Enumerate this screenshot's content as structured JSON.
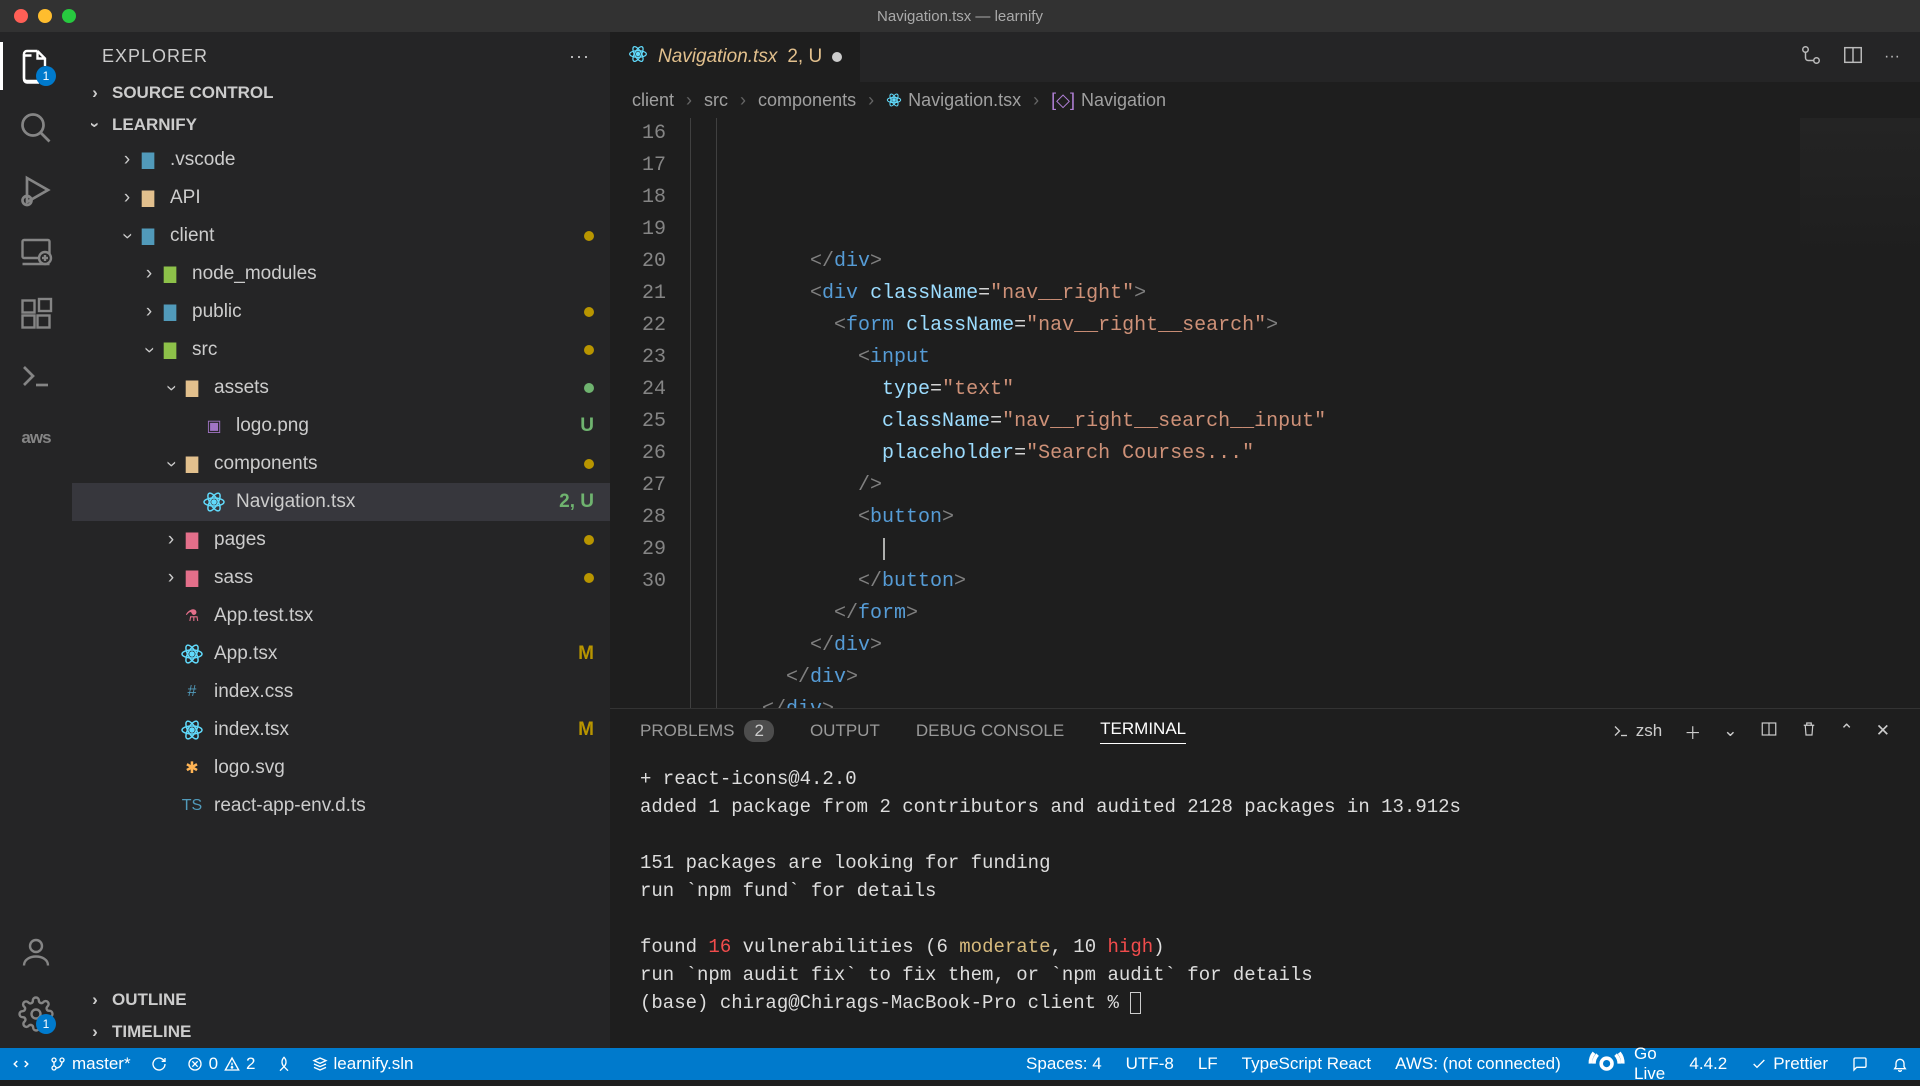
{
  "window": {
    "title": "Navigation.tsx — learnify"
  },
  "activity": {
    "explorer_badge": "1",
    "settings_badge": "1"
  },
  "explorer": {
    "title": "EXPLORER",
    "sections": {
      "source_control": "SOURCE CONTROL",
      "project": "LEARNIFY",
      "outline": "OUTLINE",
      "timeline": "TIMELINE"
    },
    "tree": [
      {
        "indent": 1,
        "chev": "right",
        "icon": "folder-blue",
        "label": ".vscode"
      },
      {
        "indent": 1,
        "chev": "right",
        "icon": "folder-yellow",
        "label": "API"
      },
      {
        "indent": 1,
        "chev": "down",
        "icon": "folder-blue",
        "label": "client",
        "dot": "yellow"
      },
      {
        "indent": 2,
        "chev": "right",
        "icon": "folder-green",
        "label": "node_modules"
      },
      {
        "indent": 2,
        "chev": "right",
        "icon": "folder-blue",
        "label": "public",
        "dot": "yellow"
      },
      {
        "indent": 2,
        "chev": "down",
        "icon": "folder-green",
        "label": "src",
        "dot": "yellow"
      },
      {
        "indent": 3,
        "chev": "down",
        "icon": "folder-yellow",
        "label": "assets",
        "dot": "green"
      },
      {
        "indent": 4,
        "icon": "image",
        "label": "logo.png",
        "status": "U",
        "statusClass": "u"
      },
      {
        "indent": 3,
        "chev": "down",
        "icon": "folder-yellow",
        "label": "components",
        "dot": "yellow"
      },
      {
        "indent": 4,
        "icon": "react",
        "label": "Navigation.tsx",
        "status": "2, U",
        "statusClass": "u",
        "selected": true
      },
      {
        "indent": 3,
        "chev": "right",
        "icon": "folder-pink",
        "label": "pages",
        "dot": "yellow"
      },
      {
        "indent": 3,
        "chev": "right",
        "icon": "folder-pink",
        "label": "sass",
        "dot": "yellow"
      },
      {
        "indent": 3,
        "icon": "test",
        "label": "App.test.tsx"
      },
      {
        "indent": 3,
        "icon": "react",
        "label": "App.tsx",
        "status": "M",
        "statusClass": "m"
      },
      {
        "indent": 3,
        "icon": "css",
        "label": "index.css"
      },
      {
        "indent": 3,
        "icon": "react",
        "label": "index.tsx",
        "status": "M",
        "statusClass": "m"
      },
      {
        "indent": 3,
        "icon": "svg",
        "label": "logo.svg"
      },
      {
        "indent": 3,
        "icon": "ts",
        "label": "react-app-env.d.ts"
      }
    ]
  },
  "tab": {
    "name": "Navigation.tsx",
    "badge": "2, U"
  },
  "breadcrumbs": [
    "client",
    "src",
    "components",
    "Navigation.tsx",
    "Navigation"
  ],
  "code": {
    "start": 16,
    "lines": [
      [
        [
          "brkt",
          "          </"
        ],
        [
          "tag",
          "div"
        ],
        [
          "brkt",
          ">"
        ]
      ],
      [
        [
          "brkt",
          "          <"
        ],
        [
          "tag",
          "div"
        ],
        [
          "eq",
          " "
        ],
        [
          "attr",
          "className"
        ],
        [
          "eq",
          "="
        ],
        [
          "str",
          "\"nav__right\""
        ],
        [
          "brkt",
          ">"
        ]
      ],
      [
        [
          "brkt",
          "            <"
        ],
        [
          "tag",
          "form"
        ],
        [
          "eq",
          " "
        ],
        [
          "attr",
          "className"
        ],
        [
          "eq",
          "="
        ],
        [
          "str",
          "\"nav__right__search\""
        ],
        [
          "brkt",
          ">"
        ]
      ],
      [
        [
          "brkt",
          "              <"
        ],
        [
          "tag",
          "input"
        ]
      ],
      [
        [
          "eq",
          "                "
        ],
        [
          "attr",
          "type"
        ],
        [
          "eq",
          "="
        ],
        [
          "str",
          "\"text\""
        ]
      ],
      [
        [
          "eq",
          "                "
        ],
        [
          "attr",
          "className"
        ],
        [
          "eq",
          "="
        ],
        [
          "str",
          "\"nav__right__search__input\""
        ]
      ],
      [
        [
          "eq",
          "                "
        ],
        [
          "attr",
          "placeholder"
        ],
        [
          "eq",
          "="
        ],
        [
          "str",
          "\"Search Courses...\""
        ]
      ],
      [
        [
          "brkt",
          "              />"
        ]
      ],
      [
        [
          "brkt",
          "              <"
        ],
        [
          "tag",
          "button"
        ],
        [
          "brkt",
          ">"
        ]
      ],
      [
        [
          "eq",
          "                "
        ]
      ],
      [
        [
          "brkt",
          "              </"
        ],
        [
          "tag",
          "button"
        ],
        [
          "brkt",
          ">"
        ]
      ],
      [
        [
          "brkt",
          "            </"
        ],
        [
          "tag",
          "form"
        ],
        [
          "brkt",
          ">"
        ]
      ],
      [
        [
          "brkt",
          "          </"
        ],
        [
          "tag",
          "div"
        ],
        [
          "brkt",
          ">"
        ]
      ],
      [
        [
          "brkt",
          "        </"
        ],
        [
          "tag",
          "div"
        ],
        [
          "brkt",
          ">"
        ]
      ],
      [
        [
          "brkt",
          "      </"
        ],
        [
          "tag",
          "div"
        ],
        [
          "brkt",
          ">"
        ]
      ]
    ],
    "cursor_line": 25
  },
  "panel": {
    "tabs": {
      "problems": "PROBLEMS",
      "problems_count": "2",
      "output": "OUTPUT",
      "debug": "DEBUG CONSOLE",
      "terminal": "TERMINAL"
    },
    "shell": "zsh",
    "terminal_lines": [
      "+ react-icons@4.2.0",
      "added 1 package from 2 contributors and audited 2128 packages in 13.912s",
      "",
      "151 packages are looking for funding",
      "  run `npm fund` for details",
      "",
      "found 16 vulnerabilities (6 moderate, 10 high)",
      "  run `npm audit fix` to fix them, or `npm audit` for details",
      "(base) chirag@Chirags-MacBook-Pro client % "
    ]
  },
  "status": {
    "remote": "",
    "branch": "master*",
    "errors": "0",
    "warnings": "2",
    "solution": "learnify.sln",
    "spaces": "Spaces: 4",
    "encoding": "UTF-8",
    "eol": "LF",
    "lang": "TypeScript React",
    "aws": "AWS: (not connected)",
    "golive": "Go Live",
    "version": "4.4.2",
    "prettier": "Prettier"
  }
}
